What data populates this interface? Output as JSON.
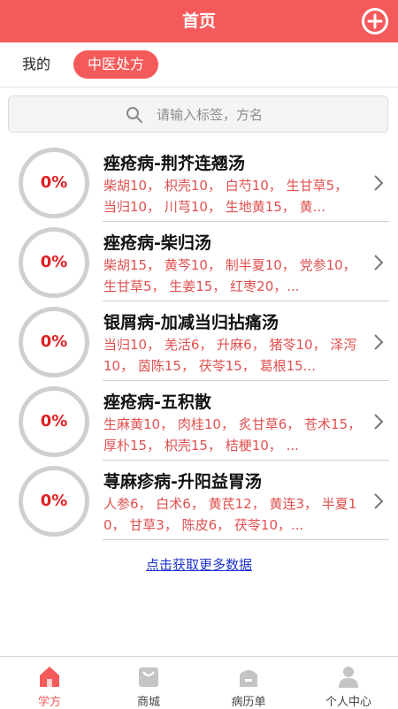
{
  "header": {
    "title": "首页"
  },
  "tabs": [
    {
      "label": "我的"
    },
    {
      "label": "中医处方"
    }
  ],
  "search": {
    "placeholder": "请输入标签，方名"
  },
  "prescriptions": [
    {
      "percent": "0%",
      "name": "痤疮病-荆芥连翘汤",
      "herbs": "柴胡10， 枳壳10， 白芍10， 生甘草5， 当归10， 川芎10， 生地黄15， 黄..."
    },
    {
      "percent": "0%",
      "name": "痤疮病-柴归汤",
      "herbs": "柴胡15， 黄芩10， 制半夏10， 党参10，生甘草5， 生姜15， 红枣20，..."
    },
    {
      "percent": "0%",
      "name": "银屑病-加减当归拈痛汤",
      "herbs": "当归10， 羌活6， 升麻6， 猪苓10， 泽泻10， 茵陈15， 茯苓15， 葛根15..."
    },
    {
      "percent": "0%",
      "name": "痤疮病-五积散",
      "herbs": "生麻黄10， 肉桂10， 炙甘草6， 苍术15， 厚朴15， 枳壳15， 桔梗10， ..."
    },
    {
      "percent": "0%",
      "name": "荨麻疹病-升阳益胃汤",
      "herbs": "人参6， 白术6， 黄芪12， 黄连3， 半夏10， 甘草3， 陈皮6， 茯苓10，..."
    }
  ],
  "more_link": "点击获取更多数据",
  "bottom_nav": [
    {
      "label": "学方"
    },
    {
      "label": "商城"
    },
    {
      "label": "病历单"
    },
    {
      "label": "个人中心"
    }
  ],
  "colors": {
    "accent": "#f55a5a",
    "herbs": "#e05050",
    "link": "#2033cc"
  }
}
